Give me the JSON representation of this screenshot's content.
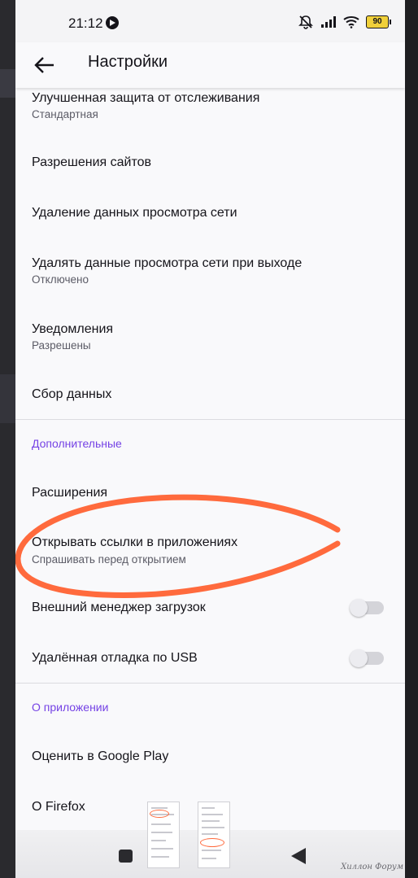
{
  "status_bar": {
    "time": "21:12",
    "battery": "90"
  },
  "app_bar": {
    "title": "Настройки"
  },
  "items": [
    {
      "title": "Улучшенная защита от отслеживания",
      "subtitle": "Стандартная"
    },
    {
      "title": "Разрешения сайтов"
    },
    {
      "title": "Удаление данных просмотра сети"
    },
    {
      "title": "Удалять данные просмотра сети при выходе",
      "subtitle": "Отключено"
    },
    {
      "title": "Уведомления",
      "subtitle": "Разрешены"
    },
    {
      "title": "Сбор данных"
    }
  ],
  "sections": {
    "advanced": "Дополнительные",
    "about": "О приложении"
  },
  "advanced_items": [
    {
      "title": "Расширения"
    },
    {
      "title": "Открывать ссылки в приложениях",
      "subtitle": "Спрашивать перед открытием"
    },
    {
      "title": "Внешний менеджер загрузок",
      "toggle_on": false
    },
    {
      "title": "Удалённая отладка по USB",
      "toggle_on": false
    }
  ],
  "about_items": [
    {
      "title": "Оценить в Google Play"
    },
    {
      "title": "О Firefox"
    }
  ],
  "colors": {
    "accent": "#7542e5",
    "annotation": "#ff6a3d"
  },
  "watermark": "Хиллон Форум"
}
